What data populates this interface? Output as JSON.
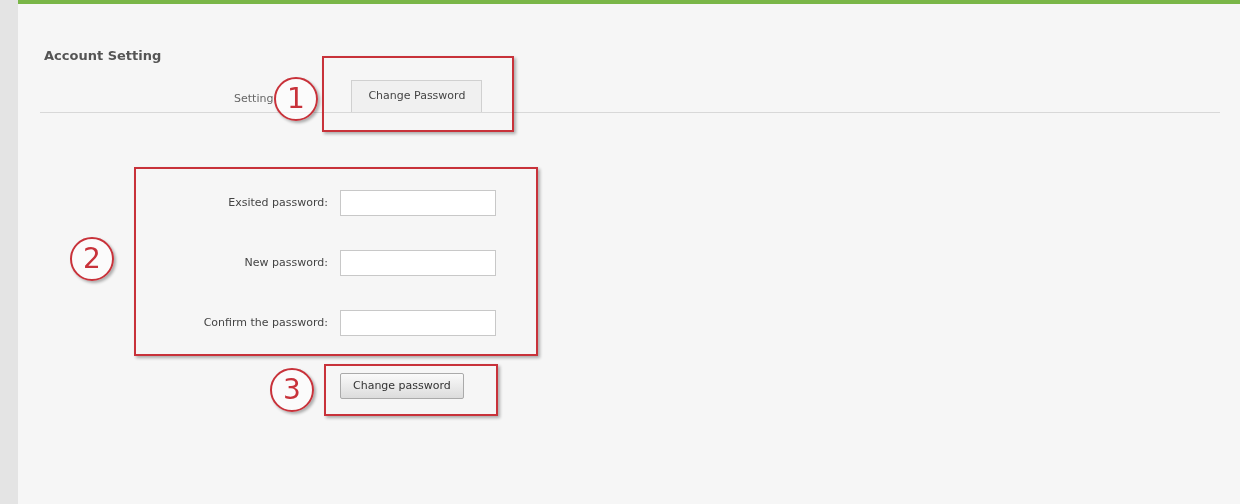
{
  "panel": {
    "title": "Account Setting"
  },
  "tabs": [
    {
      "label": "Setting",
      "selected": false
    },
    {
      "label": "Change Password",
      "selected": true
    }
  ],
  "form": {
    "fields": [
      {
        "label": "Exsited password:"
      },
      {
        "label": "New password:"
      },
      {
        "label": "Confirm the password:"
      }
    ],
    "submit": "Change password"
  },
  "callouts": [
    {
      "number": "1"
    },
    {
      "number": "2"
    },
    {
      "number": "3"
    }
  ]
}
